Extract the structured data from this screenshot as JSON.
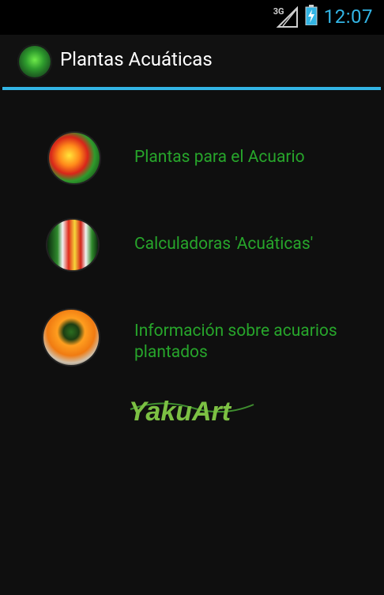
{
  "status_bar": {
    "network": "3G",
    "time": "12:07"
  },
  "action_bar": {
    "title": "Plantas Acuáticas",
    "app_icon": "aquatic-plant-icon"
  },
  "menu": [
    {
      "label": "Plantas para el Acuario",
      "icon": "aquarium-plants-icon"
    },
    {
      "label": "Calculadoras 'Acuáticas'",
      "icon": "calculator-icon"
    },
    {
      "label": "Información sobre acuarios plantados",
      "icon": "book-info-icon"
    }
  ],
  "logo": {
    "text": "YakuArt"
  },
  "colors": {
    "accent": "#33b5e5",
    "menu_text": "#27a52b",
    "background": "#0f0f0f"
  }
}
